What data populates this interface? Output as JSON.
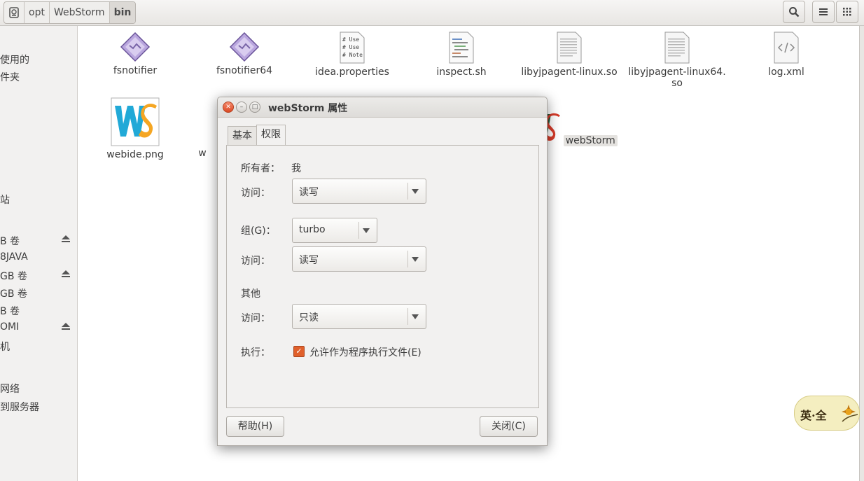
{
  "header": {
    "breadcrumbs": [
      "opt",
      "WebStorm",
      "bin"
    ],
    "buttons": [
      "search-icon",
      "list-view-icon",
      "grid-view-icon"
    ]
  },
  "sidebar": {
    "items": [
      {
        "label": "使用的"
      },
      {
        "label": "件夹"
      },
      {
        "label": "站"
      },
      {
        "label": "B 卷",
        "eject": true
      },
      {
        "label": "8JAVA"
      },
      {
        "label": "GB 卷",
        "eject": true
      },
      {
        "label": "GB 卷"
      },
      {
        "label": "B 卷"
      },
      {
        "label": "OMI",
        "eject": true
      },
      {
        "label": "机"
      },
      {
        "label": "网络"
      },
      {
        "label": "到服务器"
      }
    ]
  },
  "files": [
    {
      "name": "fsnotifier",
      "icon": "binary-diamond-icon"
    },
    {
      "name": "fsnotifier64",
      "icon": "binary-diamond-icon"
    },
    {
      "name": "idea.properties",
      "icon": "text-file-icon"
    },
    {
      "name": "inspect.sh",
      "icon": "script-file-icon"
    },
    {
      "name": "libyjpagent-linux.so",
      "icon": "library-file-icon"
    },
    {
      "name": "libyjpagent-linux64.",
      "name2": "so",
      "icon": "library-file-icon"
    },
    {
      "name": "log.xml",
      "icon": "xml-file-icon"
    },
    {
      "name": "webide.png",
      "icon": "ws-image-icon"
    },
    {
      "name": "w",
      "icon": "partially-hidden-file"
    },
    {
      "name": "webStorm",
      "icon": "ws-launcher-icon"
    }
  ],
  "properties_icon_lines": [
    "# Use",
    "# Use",
    "# Note"
  ],
  "dialog": {
    "title": "webStorm 属性",
    "tabs": [
      "基本",
      "权限"
    ],
    "active_tab": "权限",
    "owner_label": "所有者：",
    "owner_value": "我",
    "owner_access_label": "访问：",
    "owner_access_value": "读写",
    "group_label": "组(G)：",
    "group_value": "turbo",
    "group_access_label": "访问：",
    "group_access_value": "读写",
    "others_label": "其他",
    "others_access_label": "访问：",
    "others_access_value": "只读",
    "exec_label": "执行：",
    "exec_checkbox_label": "允许作为程序执行文件(E)",
    "exec_checked": true,
    "help_button": "帮助(H)",
    "close_button": "关闭(C)",
    "accent": "#e0602b"
  },
  "watermark": {
    "text": "英·全"
  }
}
